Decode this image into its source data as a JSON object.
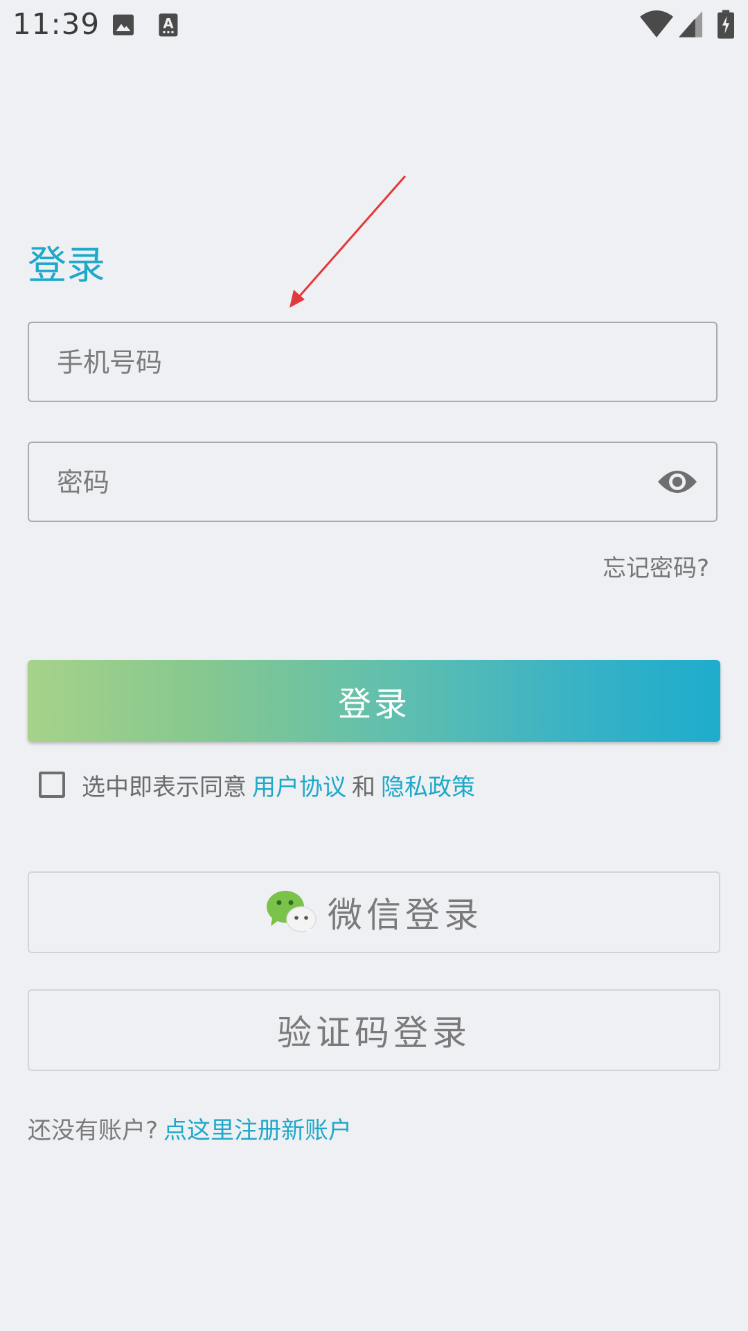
{
  "status_bar": {
    "time": "11:39",
    "left_icons": [
      "image-icon",
      "text-a-icon"
    ],
    "right_icons": [
      "wifi-icon",
      "cell-signal-icon",
      "battery-charging-icon"
    ]
  },
  "page": {
    "title": "登录"
  },
  "form": {
    "phone_placeholder": "手机号码",
    "password_placeholder": "密码",
    "password_toggle_icon": "eye-icon",
    "forgot_password": "忘记密码?"
  },
  "login_button": {
    "label": "登录"
  },
  "agreement": {
    "checked": false,
    "prefix": "选中即表示同意",
    "user_agreement": "用户协议",
    "and": "和",
    "privacy_policy": "隐私政策"
  },
  "wechat_login": {
    "label": "微信登录",
    "icon": "wechat-icon"
  },
  "code_login": {
    "label": "验证码登录"
  },
  "register": {
    "prompt": "还没有账户?",
    "link": "点这里注册新账户"
  },
  "colors": {
    "accent": "#1ea8c9",
    "background": "#eff0f3",
    "gradient_start": "#a6d28a",
    "gradient_end": "#1eaccd",
    "annotation": "#e03a3a"
  }
}
